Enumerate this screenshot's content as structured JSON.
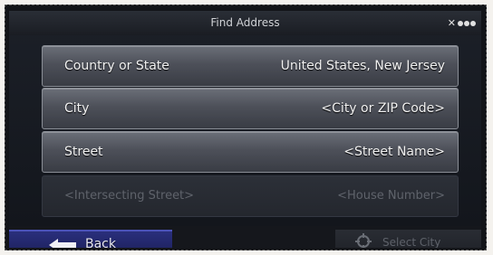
{
  "header": {
    "title": "Find Address",
    "status_icons": [
      "satellite-icon",
      "signal-dots-icon"
    ]
  },
  "fields": [
    {
      "label": "Country or State",
      "value": "United States, New Jersey",
      "enabled": true
    },
    {
      "label": "City",
      "value": "<City or ZIP Code>",
      "enabled": true
    },
    {
      "label": "Street",
      "value": "<Street Name>",
      "enabled": true
    },
    {
      "label": "<Intersecting Street>",
      "value": "<House Number>",
      "enabled": false
    }
  ],
  "footer": {
    "back_label": "Back",
    "select_label": "Select City"
  },
  "colors": {
    "row_active": "#4d5059",
    "row_disabled": "#2c3038",
    "back_button": "#2a2f7c"
  }
}
